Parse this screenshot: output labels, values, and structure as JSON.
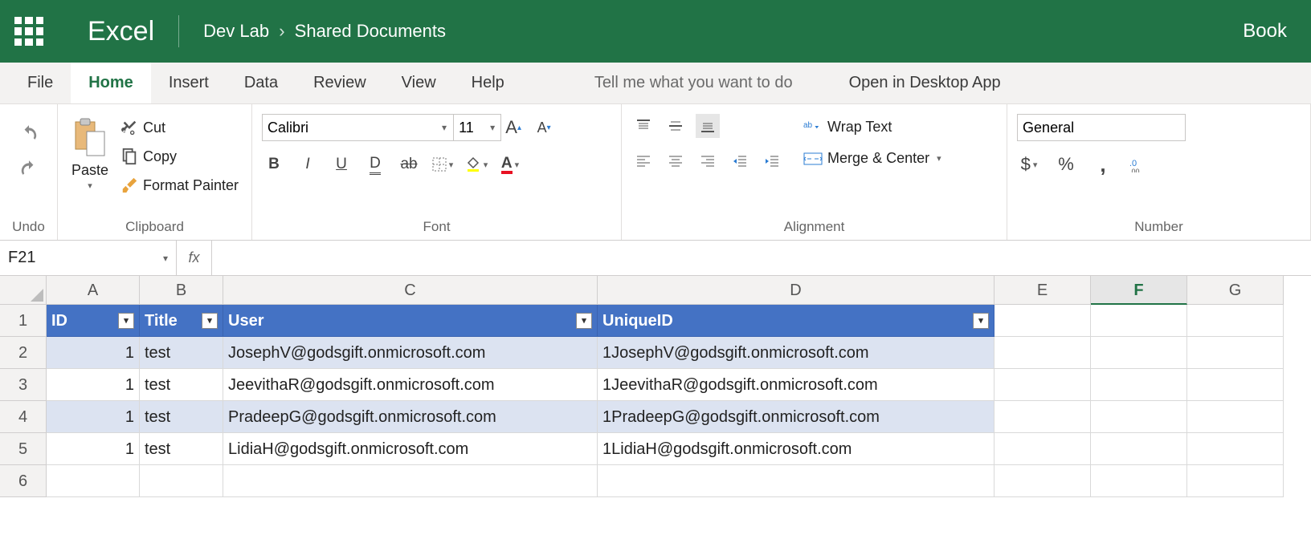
{
  "header": {
    "brand": "Excel",
    "breadcrumb": [
      "Dev Lab",
      "Shared Documents"
    ],
    "doc_name": "Book"
  },
  "tabs": {
    "items": [
      "File",
      "Home",
      "Insert",
      "Data",
      "Review",
      "View",
      "Help"
    ],
    "active_index": 1,
    "tell_me": "Tell me what you want to do",
    "open_desktop": "Open in Desktop App"
  },
  "ribbon": {
    "undo": {
      "label": "Undo"
    },
    "clipboard": {
      "paste": "Paste",
      "cut": "Cut",
      "copy": "Copy",
      "format_painter": "Format Painter",
      "label": "Clipboard"
    },
    "font": {
      "name": "Calibri",
      "size": "11",
      "label": "Font"
    },
    "alignment": {
      "wrap": "Wrap Text",
      "merge": "Merge & Center",
      "label": "Alignment"
    },
    "number": {
      "format": "General",
      "label": "Number"
    }
  },
  "formula_bar": {
    "name_box": "F21",
    "fx": "fx",
    "value": ""
  },
  "chart_data": {
    "type": "table",
    "columns": [
      "A",
      "B",
      "C",
      "D",
      "E",
      "F",
      "G"
    ],
    "selected_column": "F",
    "header_row": [
      "ID",
      "Title",
      "User",
      "UniqueID"
    ],
    "rows": [
      {
        "id": "1",
        "title": "test",
        "user": "JosephV@godsgift.onmicrosoft.com",
        "unique": "1JosephV@godsgift.onmicrosoft.com"
      },
      {
        "id": "1",
        "title": "test",
        "user": "JeevithaR@godsgift.onmicrosoft.com",
        "unique": "1JeevithaR@godsgift.onmicrosoft.com"
      },
      {
        "id": "1",
        "title": "test",
        "user": "PradeepG@godsgift.onmicrosoft.com",
        "unique": "1PradeepG@godsgift.onmicrosoft.com"
      },
      {
        "id": "1",
        "title": "test",
        "user": "LidiaH@godsgift.onmicrosoft.com",
        "unique": "1LidiaH@godsgift.onmicrosoft.com"
      }
    ],
    "row_numbers": [
      "1",
      "2",
      "3",
      "4",
      "5",
      "6"
    ]
  }
}
